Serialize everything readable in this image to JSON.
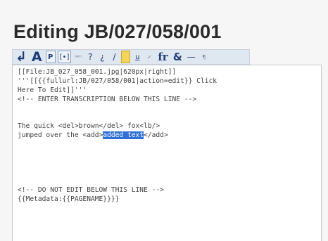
{
  "page": {
    "title": "Editing JB/027/058/001"
  },
  "toolbar": {
    "buttons": [
      {
        "name": "undo-icon",
        "glyph": "↲"
      },
      {
        "name": "font-size-icon",
        "glyph": "A"
      },
      {
        "name": "paragraph-button",
        "glyph": "P"
      },
      {
        "name": "insert-button",
        "glyph": "[•]"
      },
      {
        "name": "small-button",
        "glyph": "ʷᵐ"
      },
      {
        "name": "question-button",
        "glyph": "?"
      },
      {
        "name": "sic-button",
        "glyph": "¿"
      },
      {
        "name": "strike-button",
        "glyph": "/"
      },
      {
        "name": "highlight-icon",
        "glyph": ""
      },
      {
        "name": "underline-button",
        "glyph": "u"
      },
      {
        "name": "marginal-button",
        "glyph": "✓"
      },
      {
        "name": "foreign-button",
        "glyph": "fr"
      },
      {
        "name": "ampersand-button",
        "glyph": "&"
      },
      {
        "name": "dash-button",
        "glyph": "—"
      },
      {
        "name": "note-button",
        "glyph": "¶"
      }
    ]
  },
  "editor": {
    "lines": [
      "[[File:JB_027_058_001.jpg|620px|right]]",
      "'''[[{{fullurl:JB/027/058/001|action=edit}} Click",
      "Here To Edit]]'''",
      "<!-- ENTER TRANSCRIPTION BELOW THIS LINE -->",
      "",
      "The quick <del>brown</del> fox<lb/>",
      "jumped over the <add>",
      "",
      "",
      "",
      "<!-- DO NOT EDIT BELOW THIS LINE -->",
      "{{Metadata:{{PAGENAME}}}}"
    ],
    "selected_text": "added text",
    "after_selection": "</add>"
  }
}
